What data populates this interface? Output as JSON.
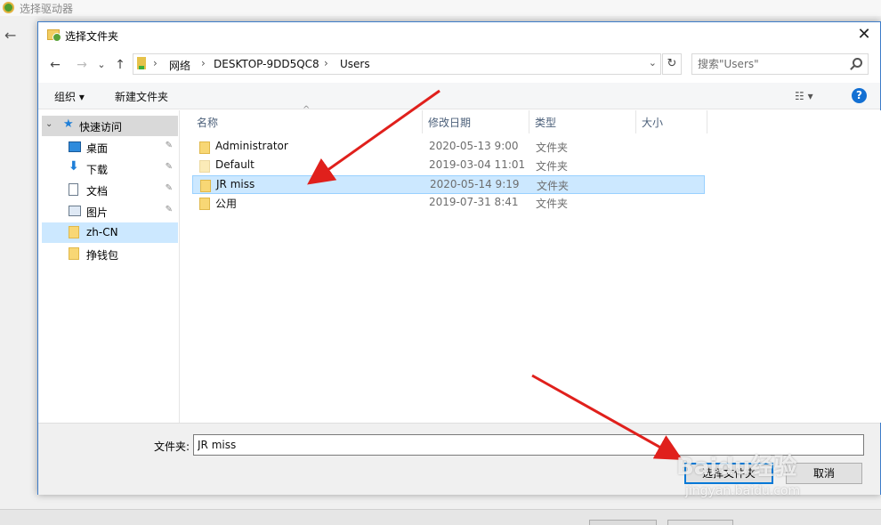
{
  "background": {
    "title": "选择驱动器",
    "back_icon": "←"
  },
  "dialog": {
    "title": "选择文件夹",
    "close": "✕"
  },
  "address": {
    "back": "←",
    "forward": "→",
    "recent": "⌄",
    "up": "↑",
    "crumbs": [
      "网络",
      "DESKTOP-9DD5QC8",
      "Users"
    ],
    "separator": "›",
    "dropdown": "⌄",
    "refresh": "↻"
  },
  "search": {
    "placeholder": "搜索\"Users\""
  },
  "toolbar": {
    "organize": "组织 ▾",
    "new_folder": "新建文件夹",
    "view": "☷ ▾",
    "help": "?"
  },
  "nav": {
    "items": [
      {
        "label": "快速访问",
        "icon": "star-icon",
        "expand": "⌄",
        "pinned": false
      },
      {
        "label": "桌面",
        "icon": "desktop-icon",
        "pinned": true
      },
      {
        "label": "下载",
        "icon": "download-icon",
        "pinned": true
      },
      {
        "label": "文档",
        "icon": "document-icon",
        "pinned": true
      },
      {
        "label": "图片",
        "icon": "picture-icon",
        "pinned": true
      },
      {
        "label": "zh-CN",
        "icon": "folder-icon",
        "pinned": false
      },
      {
        "label": "挣钱包",
        "icon": "folder-icon",
        "pinned": false
      }
    ],
    "pin_glyph": "📌"
  },
  "columns": {
    "name": "名称",
    "modified": "修改日期",
    "type": "类型",
    "size": "大小",
    "sort_glyph": "^"
  },
  "files": [
    {
      "name": "Administrator",
      "modified": "2020-05-13 9:00",
      "type": "文件夹"
    },
    {
      "name": "Default",
      "modified": "2019-03-04 11:01",
      "type": "文件夹"
    },
    {
      "name": "JR miss",
      "modified": "2020-05-14 9:19",
      "type": "文件夹"
    },
    {
      "name": "公用",
      "modified": "2019-07-31 8:41",
      "type": "文件夹"
    }
  ],
  "footer": {
    "folder_label": "文件夹:",
    "folder_value": "JR miss",
    "select_button": "选择文件夹",
    "cancel_button": "取消"
  },
  "watermark": {
    "brand": "Baidu经验",
    "url": "jingyan.baidu.com"
  },
  "colors": {
    "accent": "#0078d7",
    "selection": "#cce8ff",
    "arrow": "#e0201c"
  }
}
